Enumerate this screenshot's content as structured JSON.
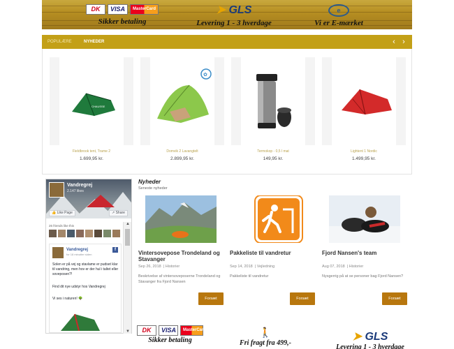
{
  "banner": {
    "payment_caption": "Sikker betaling",
    "delivery_caption": "Levering 1 - 3 hverdage",
    "emaerke_caption": "Vi er E-mærket",
    "pay_logos": [
      "DK",
      "VISA",
      "MasterCard"
    ],
    "gls_text": "GLS",
    "emaerke_logo": "e"
  },
  "tabs": {
    "popular": "Populære",
    "news": "Nyheder",
    "prev_icon": "‹",
    "next_icon": "›"
  },
  "products": [
    {
      "name": "Fieldbrook tent, Trame 2",
      "price": "1.699,95 kr.",
      "icon": "tent-green-icon",
      "color": "#1e7a3a"
    },
    {
      "name": "Domvik 2 Lavangtelt",
      "price": "2.899,95 kr.",
      "icon": "tent-lime-icon",
      "color": "#7fbf3a"
    },
    {
      "name": "Termokop - 0,5 l mat",
      "price": "149,95 kr.",
      "icon": "thermos-icon",
      "color": "#555555"
    },
    {
      "name": "Lightent 1 Nordic",
      "price": "1.499,95 kr.",
      "icon": "tent-red-icon",
      "color": "#d32a2a"
    }
  ],
  "facebook": {
    "page_name": "Vandregrej",
    "likes": "2.147 likes",
    "like_btn": "Like Page",
    "share_btn": "Share",
    "friends_text": "26 friends like this",
    "post_name": "Vandregrej",
    "post_time": "for 18 minutter siden",
    "post_text_1": "Solen er på vej og stavlame er pudset klar til vandring, men hov er der hul i taltet eller soveposen?!",
    "post_text_2": "Find dit nye udstyr hos Vandregrej",
    "post_text_3": "Vi ses i naturen!"
  },
  "news": {
    "title": "Nyheder",
    "subtitle": "Seneste nyheder",
    "button_label": "Forsæt",
    "articles": [
      {
        "title": "Vintersovepose Trondeland og Stavanger",
        "date": "Sep 26, 2018",
        "category": "Historier",
        "excerpt": "Beskrivelse af vintersoveposerne Trondeland og Stavanger fra Fjord Nansen"
      },
      {
        "title": "Pakkeliste til vandretur",
        "date": "Sep 14, 2018",
        "category": "Vejledning",
        "excerpt": "Pakkeliste til vandretur"
      },
      {
        "title": "Fjord Nansen's team",
        "date": "Aug 07, 2018",
        "category": "Historier",
        "excerpt": "Nysgerrig på at se personer bag Fjord Nansen?"
      }
    ]
  },
  "footer": {
    "payment_caption": "Sikker betaling",
    "shipping_caption": "Fri fragt fra 499,-",
    "delivery_caption": "Levering 1 - 3 hverdage"
  }
}
